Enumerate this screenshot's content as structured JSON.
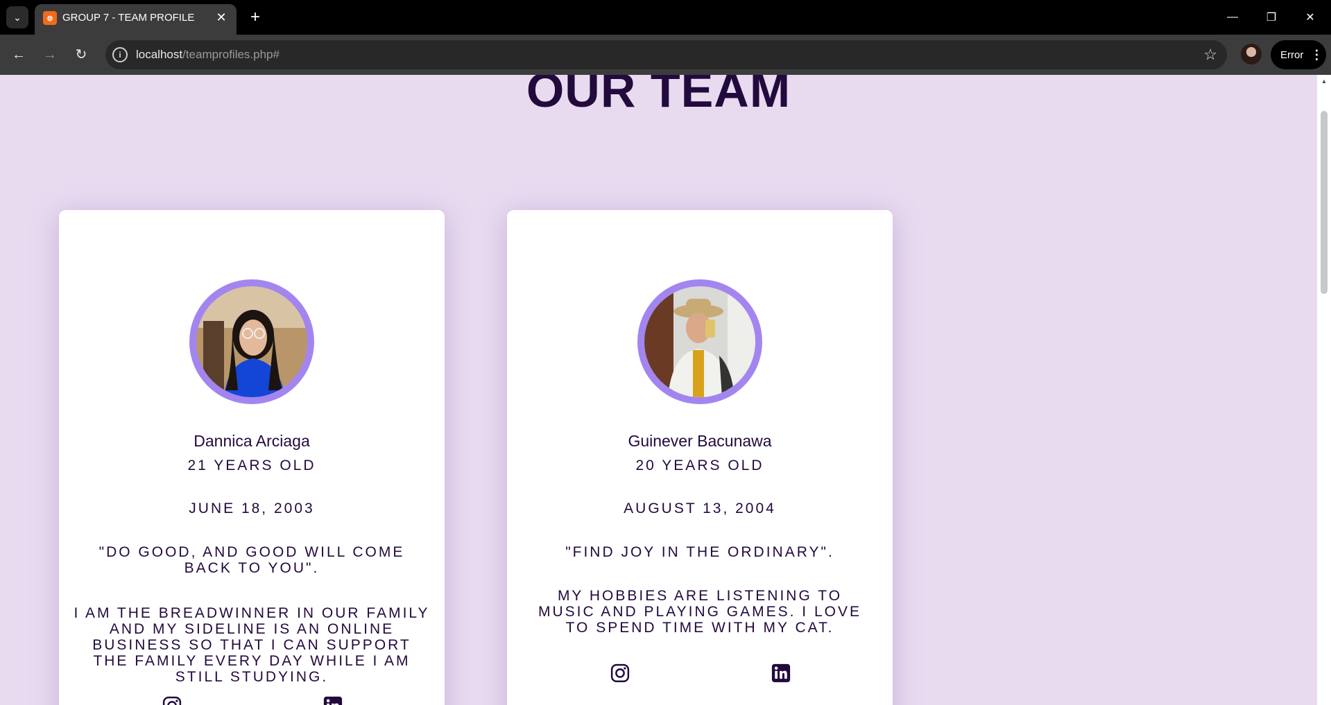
{
  "browser": {
    "tab_title": "GROUP 7 - TEAM PROFILE",
    "url_host": "localhost",
    "url_path": "/teamprofiles.php#",
    "error_label": "Error"
  },
  "page": {
    "heading": "OUR TEAM"
  },
  "members": [
    {
      "name": "Dannica Arciaga",
      "age": "21 YEARS OLD",
      "birthday": "JUNE 18, 2003",
      "quote": "\"DO GOOD, AND GOOD WILL COME BACK TO YOU\".",
      "bio": "I AM THE BREADWINNER IN OUR FAMILY AND MY SIDELINE IS AN ONLINE BUSINESS SO THAT I CAN SUPPORT THE FAMILY EVERY DAY WHILE I AM STILL STUDYING."
    },
    {
      "name": "Guinever Bacunawa",
      "age": "20 YEARS OLD",
      "birthday": "AUGUST 13, 2004",
      "quote": "\"FIND JOY IN THE ORDINARY\".",
      "bio": "MY HOBBIES ARE LISTENING TO MUSIC AND PLAYING GAMES. I LOVE TO SPEND TIME WITH MY CAT."
    }
  ],
  "colors": {
    "page_bg": "#e8dbf0",
    "text": "#230a3d",
    "avatar_ring": "#a385f0"
  }
}
